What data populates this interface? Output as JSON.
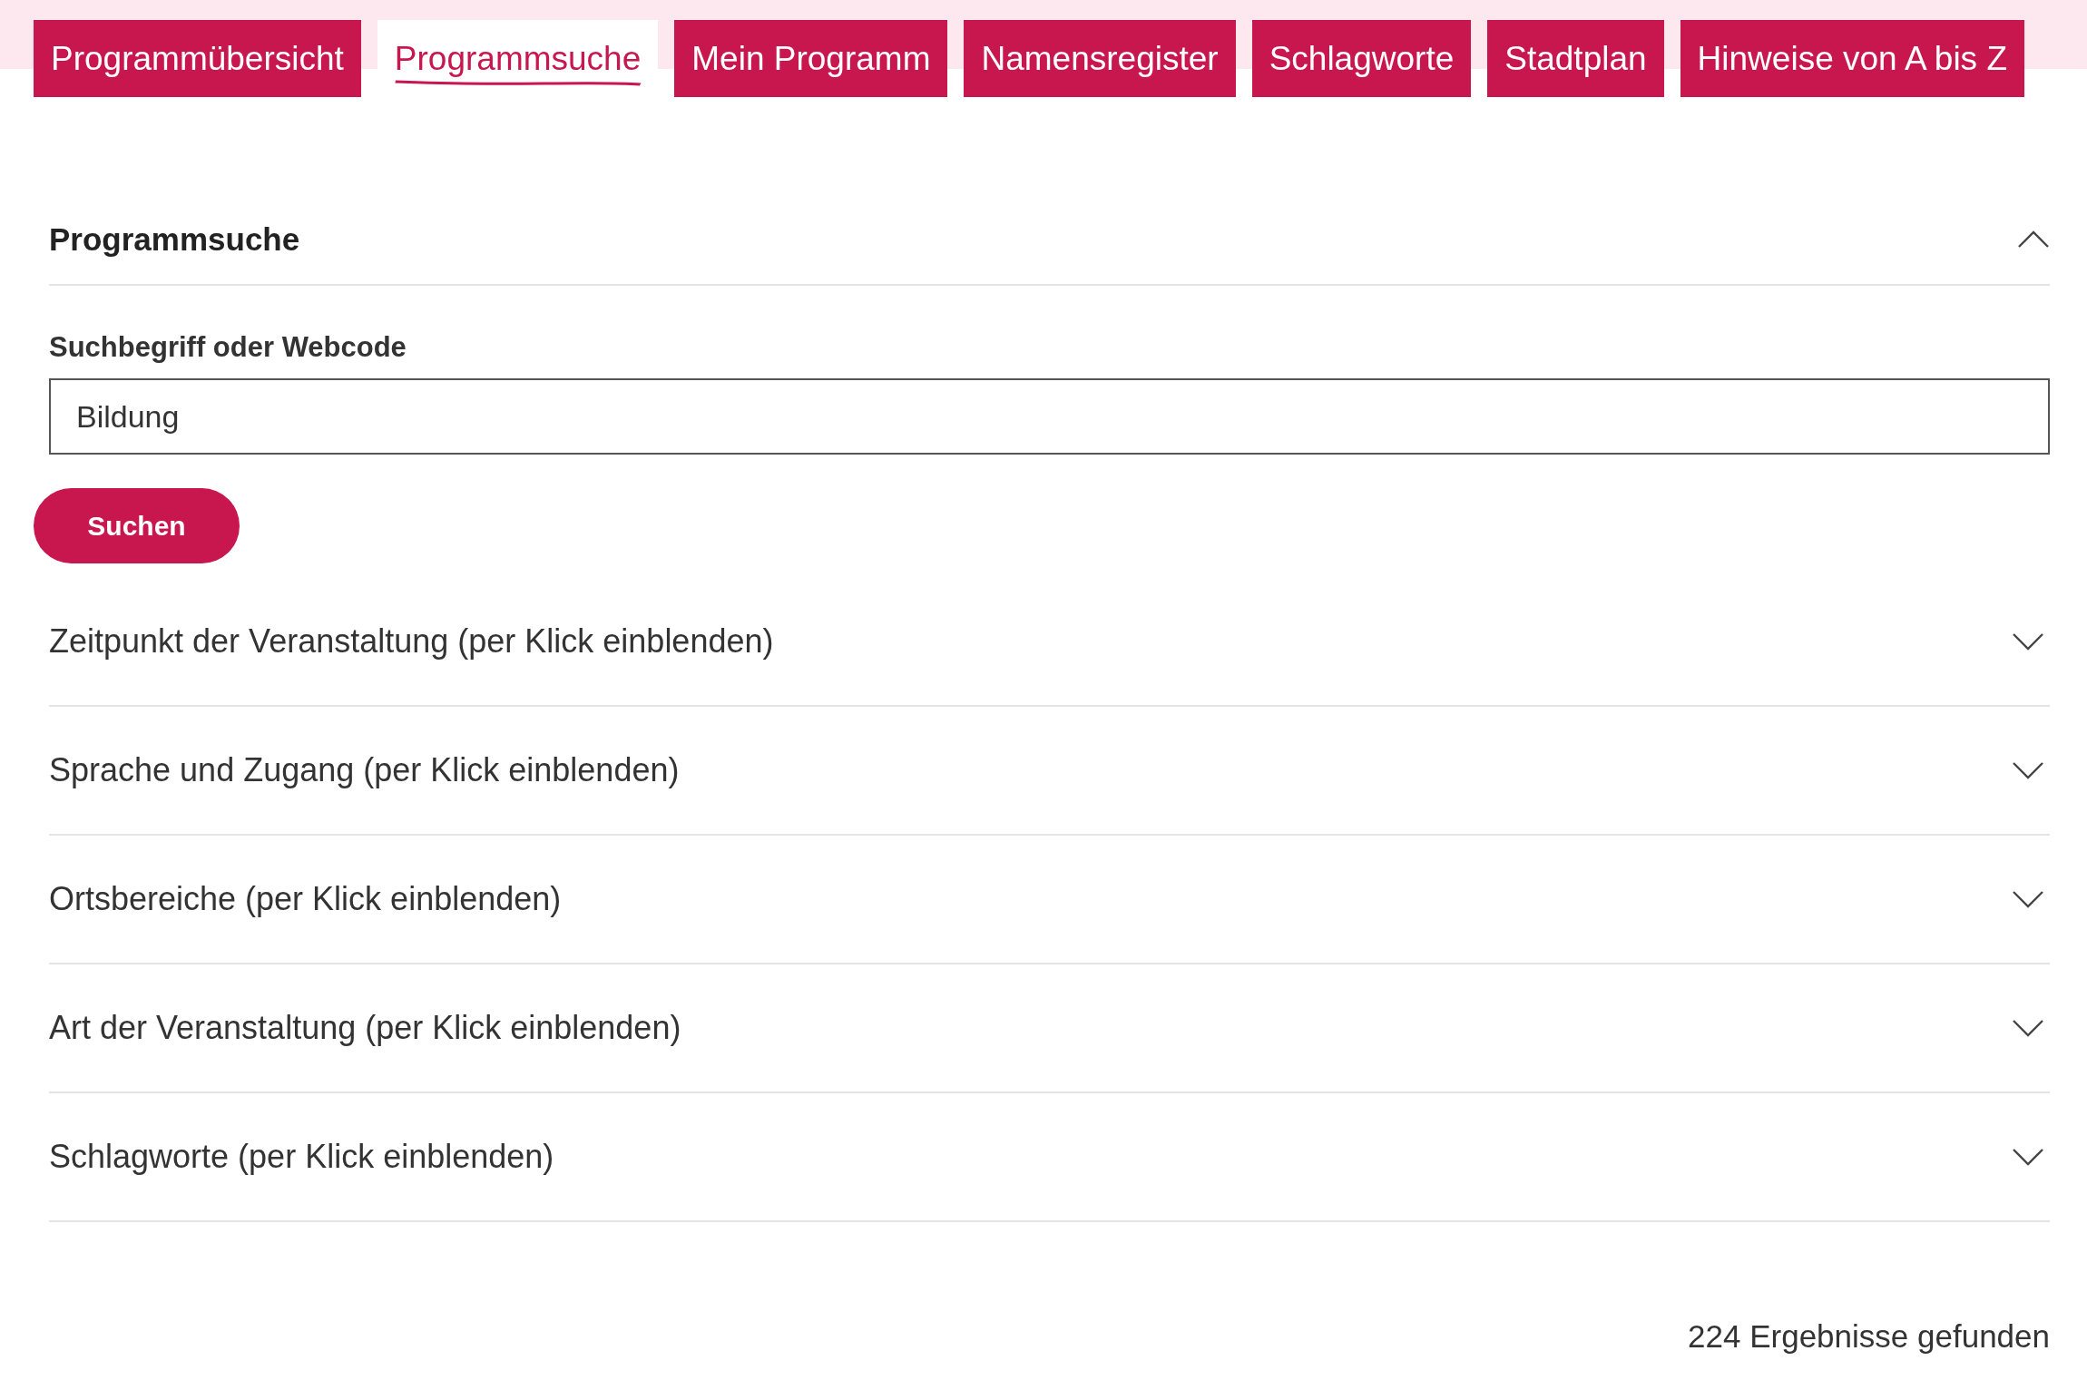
{
  "tabs": [
    {
      "label": "Programmübersicht",
      "selected": false
    },
    {
      "label": "Programmsuche",
      "selected": true
    },
    {
      "label": "Mein Programm",
      "selected": false
    },
    {
      "label": "Namensregister",
      "selected": false
    },
    {
      "label": "Schlagworte",
      "selected": false
    },
    {
      "label": "Stadtplan",
      "selected": false
    },
    {
      "label": "Hinweise von A bis Z",
      "selected": false
    }
  ],
  "search_panel": {
    "title": "Programmsuche",
    "expanded": true,
    "field_label": "Suchbegriff oder Webcode",
    "value": "Bildung",
    "button": "Suchen"
  },
  "filters": [
    {
      "label": "Zeitpunkt der Veranstaltung (per Klick einblenden)",
      "expanded": false
    },
    {
      "label": "Sprache und Zugang (per Klick einblenden)",
      "expanded": false
    },
    {
      "label": "Ortsbereiche (per Klick einblenden)",
      "expanded": false
    },
    {
      "label": "Art der Veranstaltung (per Klick einblenden)",
      "expanded": false
    },
    {
      "label": "Schlagworte (per Klick einblenden)",
      "expanded": false
    }
  ],
  "result_count": "224 Ergebnisse gefunden"
}
